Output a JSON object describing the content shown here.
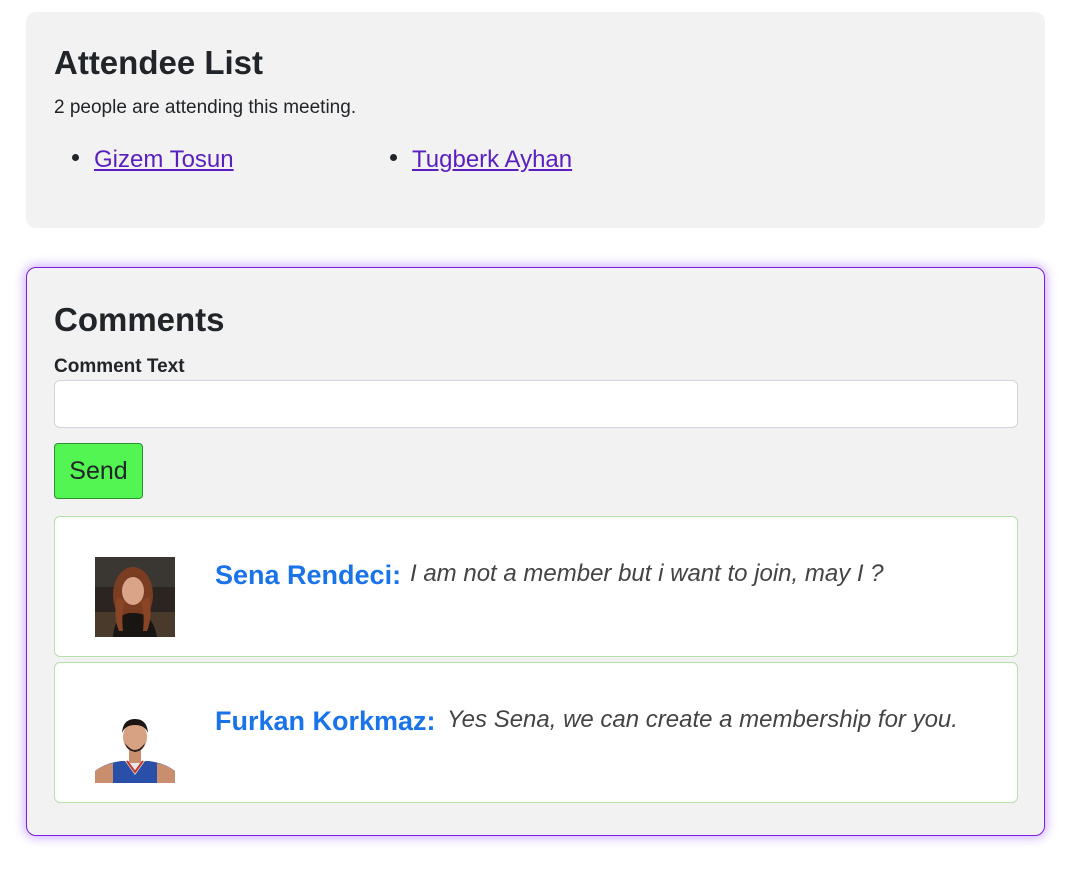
{
  "attendees": {
    "title": "Attendee List",
    "count_text": "2 people are attending this meeting.",
    "people": [
      {
        "name": "Gizem Tosun"
      },
      {
        "name": "Tugberk Ayhan"
      }
    ]
  },
  "comments": {
    "title": "Comments",
    "input_label": "Comment Text",
    "input_value": "",
    "send_label": "Send",
    "items": [
      {
        "author": "Sena Rendeci:",
        "text": "I am not a member but i want to join, may I ?"
      },
      {
        "author": "Furkan Korkmaz:",
        "text": "Yes Sena, we can create a membership for you."
      }
    ]
  },
  "colors": {
    "link": "#5a1fbf",
    "author": "#1a73e8",
    "send_button": "#52f552",
    "comments_border": "#7b1fe0",
    "card_background": "#f2f2f2"
  }
}
